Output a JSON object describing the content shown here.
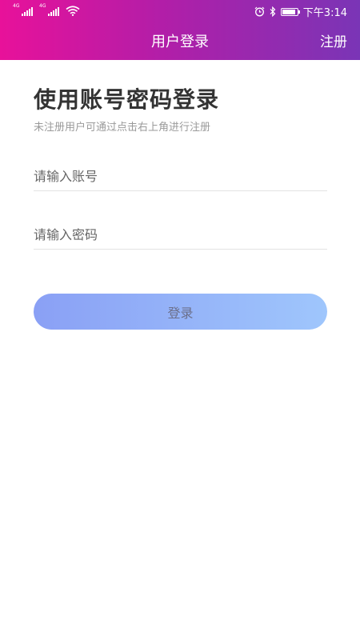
{
  "status_bar": {
    "network_tags": [
      "4G",
      "4G"
    ],
    "time": "下午3:14",
    "icons": [
      "signal-icon",
      "signal-icon",
      "wifi-icon",
      "alarm-icon",
      "bluetooth-icon",
      "battery-icon"
    ]
  },
  "navbar": {
    "title": "用户登录",
    "register_label": "注册"
  },
  "main": {
    "heading": "使用账号密码登录",
    "hint": "未注册用户可通过点击右上角进行注册",
    "account_placeholder": "请输入账号",
    "password_placeholder": "请输入密码",
    "login_label": "登录"
  },
  "colors": {
    "header_gradient_start": "#e8119a",
    "header_gradient_end": "#7a35b6",
    "button_gradient_start": "#8aa0f5",
    "button_gradient_end": "#9fc6fc"
  }
}
